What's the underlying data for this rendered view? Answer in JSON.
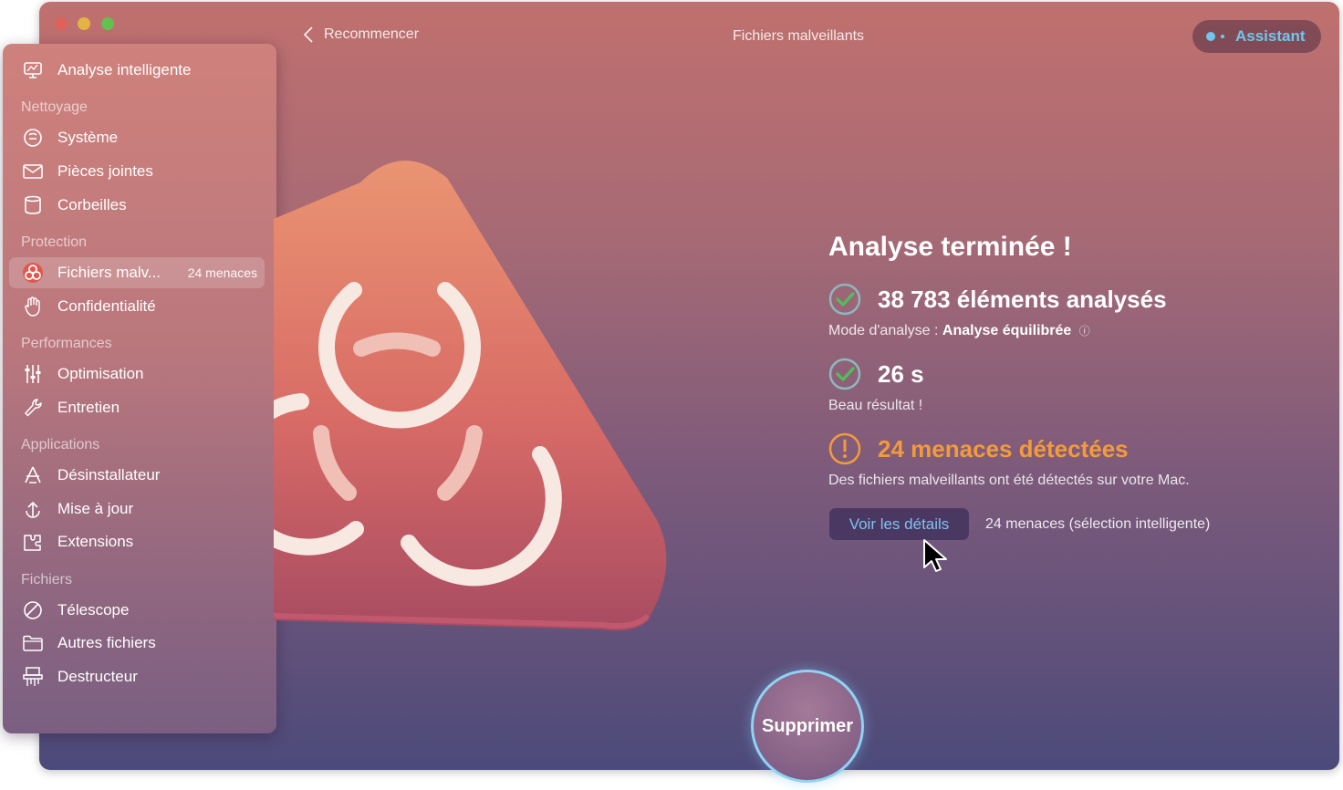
{
  "window": {
    "title": "Fichiers malveillants"
  },
  "topbar": {
    "back_label": "Recommencer",
    "assistant_label": "Assistant"
  },
  "sidebar": {
    "top_item": "Analyse intelligente",
    "sections": [
      {
        "label": "Nettoyage",
        "items": [
          "Système",
          "Pièces jointes",
          "Corbeilles"
        ]
      },
      {
        "label": "Protection",
        "items": [
          "Fichiers malv...",
          "Confidentialité"
        ]
      },
      {
        "label": "Performances",
        "items": [
          "Optimisation",
          "Entretien"
        ]
      },
      {
        "label": "Applications",
        "items": [
          "Désinstallateur",
          "Mise à jour",
          "Extensions"
        ]
      },
      {
        "label": "Fichiers",
        "items": [
          "Télescope",
          "Autres fichiers",
          "Destructeur"
        ]
      }
    ],
    "active_badge": "24 menaces"
  },
  "results": {
    "title": "Analyse terminée !",
    "analyzed": "38 783 éléments analysés",
    "mode_label": "Mode d'analyse :",
    "mode_value": "Analyse équilibrée",
    "duration": "26 s",
    "duration_note": "Beau résultat !",
    "threats": "24 menaces détectées",
    "threats_desc": "Des fichiers malveillants ont été détectés sur votre Mac.",
    "details_button": "Voir les détails",
    "details_note": "24 menaces (sélection intelligente)"
  },
  "actions": {
    "delete_label": "Supprimer"
  },
  "colors": {
    "accent_blue": "#6fc6ee",
    "warning_orange": "#f39a3c",
    "check_green": "#4fc05a"
  }
}
